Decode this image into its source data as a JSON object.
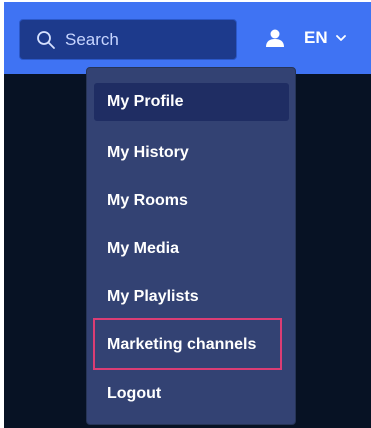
{
  "header": {
    "search_placeholder": "Search",
    "language": "EN"
  },
  "menu": {
    "items": [
      {
        "label": "My Profile",
        "active": true
      },
      {
        "label": "My History",
        "active": false
      },
      {
        "label": "My Rooms",
        "active": false
      },
      {
        "label": "My Media",
        "active": false
      },
      {
        "label": "My Playlists",
        "active": false
      },
      {
        "label": "Marketing channels",
        "active": false,
        "highlighted": true
      },
      {
        "label": "Logout",
        "active": false
      }
    ]
  },
  "icons": {
    "search": "search-icon",
    "user": "user-icon",
    "chevron": "chevron-down-icon"
  },
  "colors": {
    "top_bar": "#3f73f3",
    "search_field": "#1d3a8c",
    "background": "#071224",
    "menu": "#334273",
    "active_item": "#1f2d63",
    "highlight": "#db3d74"
  }
}
